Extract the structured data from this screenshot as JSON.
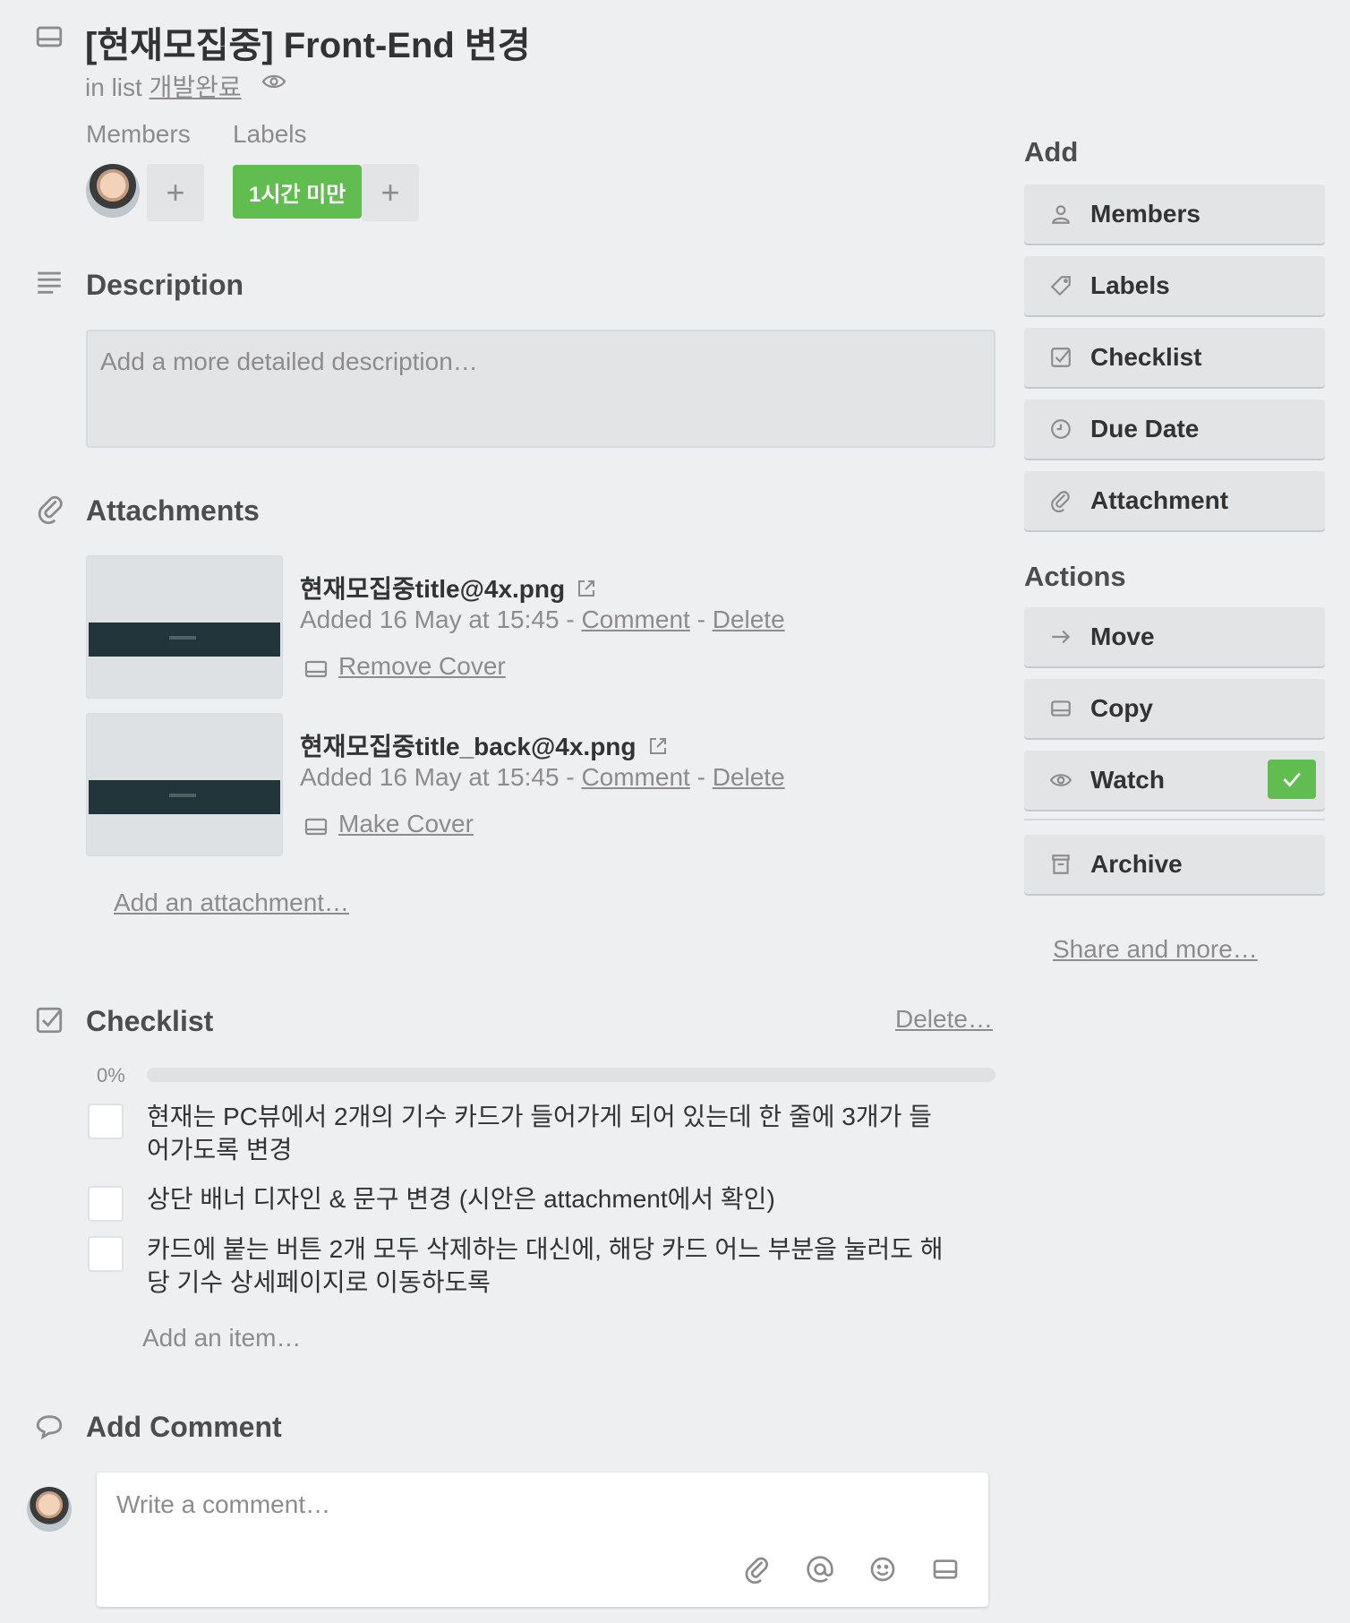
{
  "card": {
    "title": "[현재모집중] Front-End 변경",
    "in_list_prefix": "in list ",
    "list_name": "개발완료"
  },
  "members_label": "Members",
  "labels_label": "Labels",
  "label_chip": {
    "text": "1시간 미만",
    "color": "#61bd4f"
  },
  "add_symbol": "+",
  "description": {
    "title": "Description",
    "placeholder": "Add a more detailed description…"
  },
  "attachments": {
    "title": "Attachments",
    "items": [
      {
        "name": "현재모집중title@4x.png",
        "added": "Added 16 May at 15:45",
        "separator": " - ",
        "comment": "Comment",
        "delete": "Delete",
        "cover_action": "Remove Cover"
      },
      {
        "name": "현재모집중title_back@4x.png",
        "added": "Added 16 May at 15:45",
        "separator": " - ",
        "comment": "Comment",
        "delete": "Delete",
        "cover_action": "Make Cover"
      }
    ],
    "add_link": "Add an attachment…"
  },
  "checklist": {
    "title": "Checklist",
    "delete_link": "Delete…",
    "percent": "0%",
    "progress": 0,
    "items": [
      {
        "text": "현재는 PC뷰에서 2개의 기수 카드가 들어가게 되어 있는데 한 줄에 3개가 들어가도록 변경",
        "checked": false
      },
      {
        "text": "상단 배너 디자인 & 문구 변경 (시안은 attachment에서 확인)",
        "checked": false
      },
      {
        "text": "카드에 붙는 버튼 2개 모두 삭제하는 대신에, 해당 카드 어느 부분을 눌러도 해당 기수 상세페이지로 이동하도록",
        "checked": false
      }
    ],
    "add_item": "Add an item…"
  },
  "comment": {
    "title": "Add Comment",
    "placeholder": "Write a comment…",
    "tools": [
      "paperclip-icon",
      "at-icon",
      "emoji-icon",
      "card-icon"
    ]
  },
  "sidebar": {
    "add_heading": "Add",
    "add_buttons": {
      "members": "Members",
      "labels": "Labels",
      "checklist": "Checklist",
      "due_date": "Due Date",
      "attachment": "Attachment"
    },
    "actions_heading": "Actions",
    "action_buttons": {
      "move": "Move",
      "copy": "Copy",
      "watch": "Watch",
      "archive": "Archive"
    },
    "watch_active": true,
    "share_more": "Share and more…"
  },
  "colors": {
    "background": "#edeff0",
    "button": "#e2e4e6",
    "green": "#61bd4f",
    "muted_text": "#8c8c8c"
  }
}
